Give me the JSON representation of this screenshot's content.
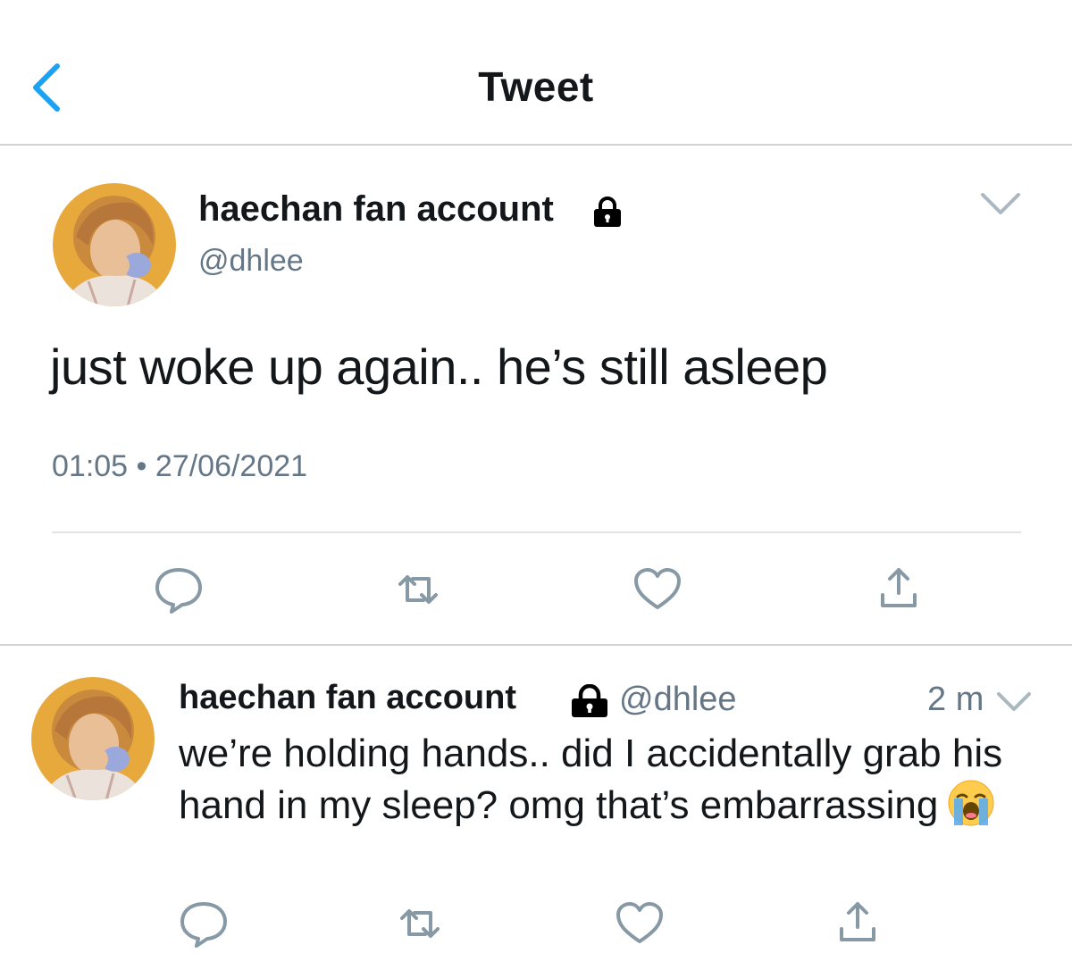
{
  "header": {
    "title": "Tweet",
    "back_icon": "chevron-left-icon"
  },
  "colors": {
    "accent": "#1da1f2",
    "secondary_text": "#657786",
    "divider": "#cfd3d6"
  },
  "main_tweet": {
    "display_name": "haechan fan account",
    "handle": "@dhlee",
    "protected_icon": "lock-icon",
    "text": "just woke up again.. he’s still asleep",
    "time": "01:05",
    "separator": "•",
    "date": "27/06/2021",
    "actions": [
      "reply-icon",
      "retweet-icon",
      "like-icon",
      "share-icon"
    ]
  },
  "reply": {
    "display_name": "haechan fan account",
    "handle": "@dhlee",
    "protected_icon": "lock-icon",
    "time": "2 m",
    "text": "we’re holding hands.. did I accidentally grab his hand in my sleep? omg that’s embarrassing",
    "emoji": "loudly-crying-face-emoji",
    "actions": [
      "reply-icon",
      "retweet-icon",
      "like-icon",
      "share-icon"
    ]
  }
}
